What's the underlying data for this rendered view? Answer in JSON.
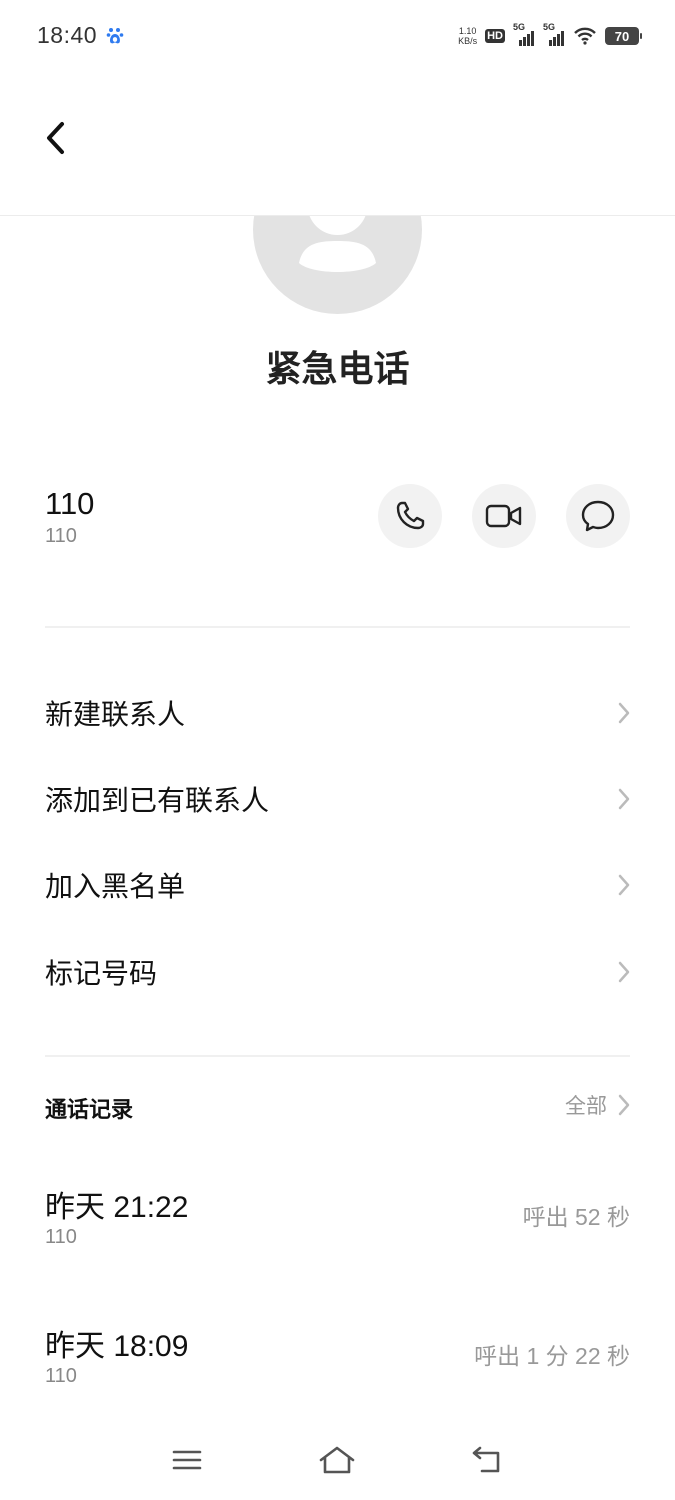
{
  "status_bar": {
    "time": "18:40",
    "net_speed_value": "1.10",
    "net_speed_unit": "KB/s",
    "hd_label": "HD",
    "sim1_label": "5G",
    "sim2_label": "5G",
    "battery": "70"
  },
  "contact": {
    "name": "紧急电话",
    "number": "110",
    "number_sub": "110"
  },
  "options": [
    {
      "label": "新建联系人"
    },
    {
      "label": "添加到已有联系人"
    },
    {
      "label": "加入黑名单"
    },
    {
      "label": "标记号码"
    }
  ],
  "call_log": {
    "title": "通话记录",
    "all_label": "全部",
    "entries": [
      {
        "time": "昨天 21:22",
        "number": "110",
        "detail": "呼出 52 秒"
      },
      {
        "time": "昨天 18:09",
        "number": "110",
        "detail": "呼出 1 分 22 秒"
      }
    ]
  },
  "icons": {
    "back": "chevron-left-icon",
    "call": "phone-icon",
    "video": "video-camera-icon",
    "message": "message-bubble-icon",
    "nav_menu": "menu-icon",
    "nav_home": "home-icon",
    "nav_back": "return-icon"
  },
  "colors": {
    "avatar_bg": "#e3e3e3",
    "action_bg": "#f2f2f2",
    "secondary_text": "#999999"
  }
}
